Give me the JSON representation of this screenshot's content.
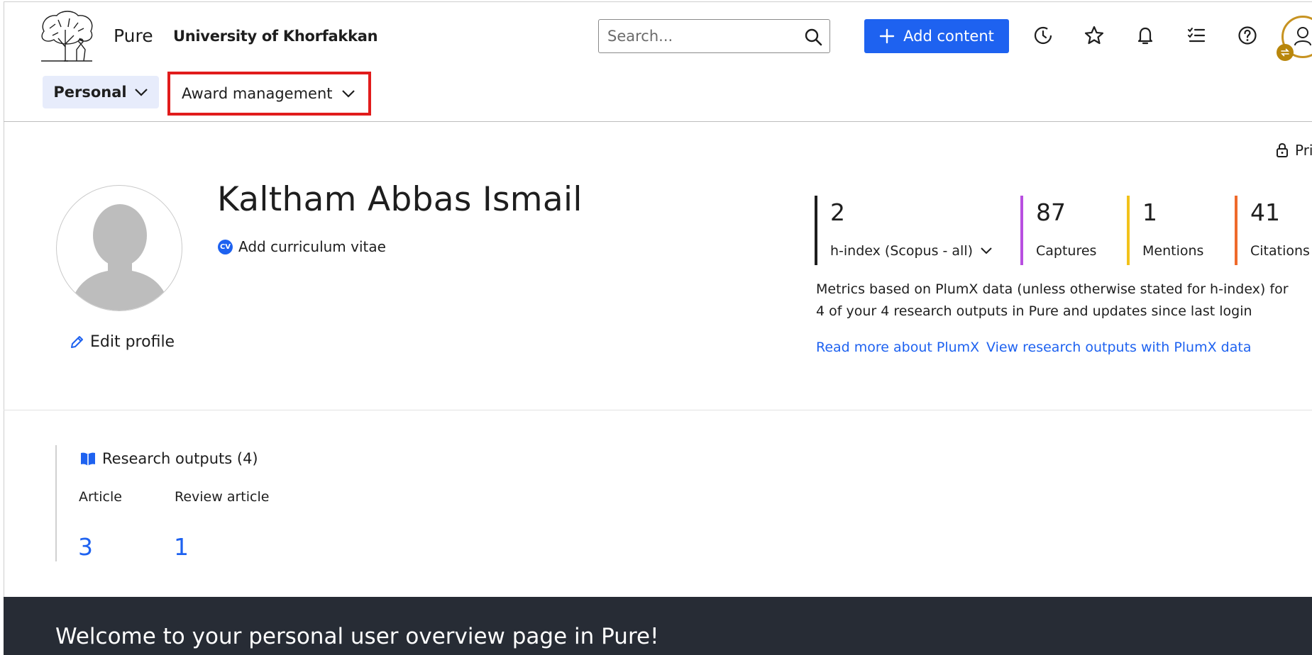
{
  "header": {
    "brand": "Pure",
    "organization": "University of Khorfakkan",
    "search_placeholder": "Search...",
    "add_content_label": "Add content",
    "icons": [
      "history-icon",
      "star-icon",
      "bell-icon",
      "tasks-icon",
      "help-icon",
      "user-icon"
    ]
  },
  "nav": {
    "personal_label": "Personal",
    "award_label": "Award management"
  },
  "profile": {
    "privacy_label": "Pri",
    "name": "Kaltham Abbas Ismail",
    "cv_badge": "CV",
    "cv_label": "Add curriculum vitae",
    "edit_label": "Edit profile"
  },
  "metrics": {
    "items": [
      {
        "value": "2",
        "label": "h-index (Scopus - all)",
        "color": "#1e1e1e"
      },
      {
        "value": "87",
        "label": "Captures",
        "color": "#b84fe0"
      },
      {
        "value": "1",
        "label": "Mentions",
        "color": "#f2c21a"
      },
      {
        "value": "41",
        "label": "Citations",
        "color": "#ef6a2b"
      }
    ],
    "note": "Metrics based on PlumX data (unless otherwise stated for h-index) for 4 of your 4 research outputs in Pure and updates since last login",
    "link_read_more": "Read more about PlumX",
    "link_view_outputs": "View research outputs with PlumX data"
  },
  "research_outputs": {
    "title": "Research outputs (4)",
    "types": [
      {
        "label": "Article",
        "count": "3"
      },
      {
        "label": "Review article",
        "count": "1"
      }
    ]
  },
  "welcome": {
    "text": "Welcome to your personal user overview page in Pure!"
  },
  "colors": {
    "accent": "#1e62f0",
    "highlight_box": "#e11c1c",
    "banner": "#272c35"
  }
}
